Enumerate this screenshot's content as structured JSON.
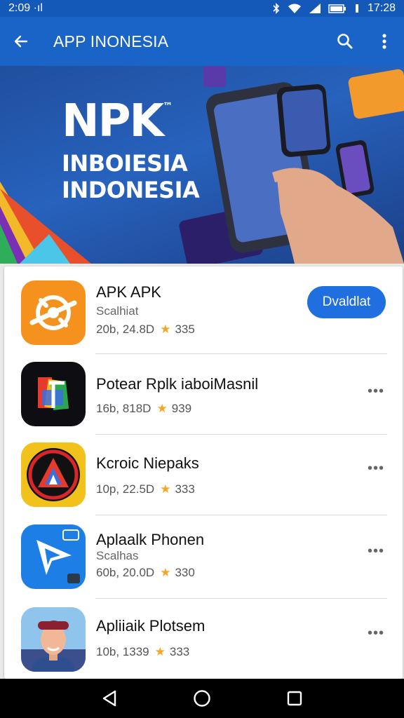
{
  "status_bar": {
    "time_left": "2:09 ·ıl",
    "time_right": "17:28"
  },
  "app_bar": {
    "title": "APP INONESIA",
    "back_icon": "arrow-left-icon",
    "search_icon": "search-icon",
    "more_icon": "more-vert-icon"
  },
  "banner": {
    "title": "NPK",
    "tm": "™",
    "line1": "INBOIESIA",
    "line2": "INDONESIA"
  },
  "apps": [
    {
      "name": "APK APK",
      "subtitle": "Scalhiat",
      "meta": "20b, 24.8D",
      "rating": "335",
      "action": "Dvaldlat",
      "icon": "orange-gear-icon"
    },
    {
      "name": "Potear Rplk iaboiMasnil",
      "subtitle": "",
      "meta": "16b, 818D",
      "rating": "939",
      "icon": "colorful-f-icon"
    },
    {
      "name": "Kcroic Niepaks",
      "subtitle": "",
      "meta": "10p, 22.5D",
      "rating": "333",
      "icon": "red-ring-triangle-icon"
    },
    {
      "name": "Aplaalk Phonen",
      "subtitle": "Scalhas",
      "meta": "60b, 20.0D",
      "rating": "330",
      "icon": "blue-play-arrow-icon"
    },
    {
      "name": "Apliiaik Plotsem",
      "subtitle": "",
      "meta": "10b, 1339",
      "rating": "333",
      "icon": "person-portrait-icon"
    }
  ],
  "colors": {
    "app_bar": "#1a64c8",
    "status_bar": "#1559b8",
    "accent_button": "#1f6fe0",
    "star": "#f5a623"
  }
}
